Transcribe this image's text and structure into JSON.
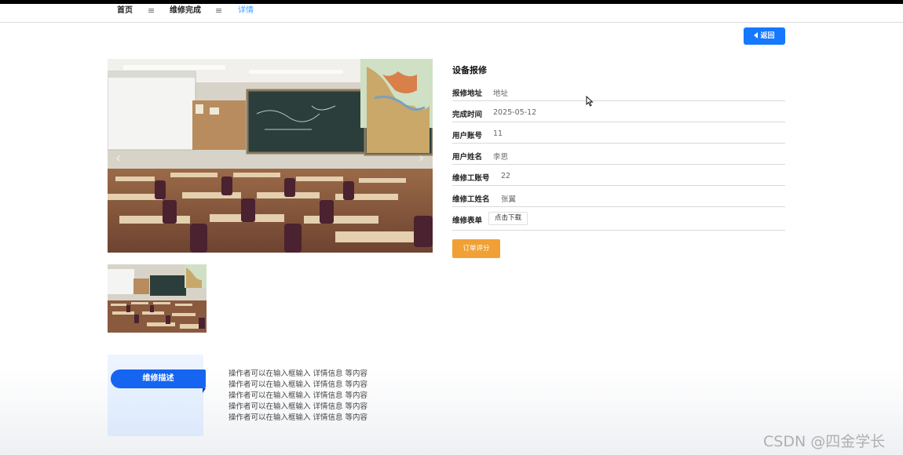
{
  "breadcrumb": {
    "home": "首页",
    "separator": "≡",
    "section": "维修完成",
    "current": "详情"
  },
  "back_button": {
    "label": "返回",
    "icon": "caret-left-icon"
  },
  "gallery": {
    "main_image": "classroom-photo",
    "thumbnail": "classroom-thumbnail"
  },
  "detail": {
    "title": "设备报修",
    "fields": [
      {
        "label": "报修地址",
        "value": "地址"
      },
      {
        "label": "完成时间",
        "value": "2025-05-12"
      },
      {
        "label": "用户账号",
        "value": "11"
      },
      {
        "label": "用户姓名",
        "value": "李思"
      },
      {
        "label": "维修工账号",
        "value": "22"
      },
      {
        "label": "维修工姓名",
        "value": "张翼"
      }
    ],
    "form_field": {
      "label": "维修表单",
      "button": "点击下载"
    },
    "rate_button": "订单评分"
  },
  "description": {
    "tab_label": "维修描述",
    "lines": [
      "操作者可以在输入框输入 详情信息 等内容",
      "操作者可以在输入框输入 详情信息 等内容",
      "操作者可以在输入框输入 详情信息 等内容",
      "操作者可以在输入框输入 详情信息 等内容",
      "操作者可以在输入框输入 详情信息 等内容"
    ]
  },
  "watermark": "CSDN @四金学长",
  "colors": {
    "primary": "#1677ff",
    "accent": "#f0a035",
    "active_crumb": "#409eff",
    "tab_blue": "#1565f0"
  }
}
